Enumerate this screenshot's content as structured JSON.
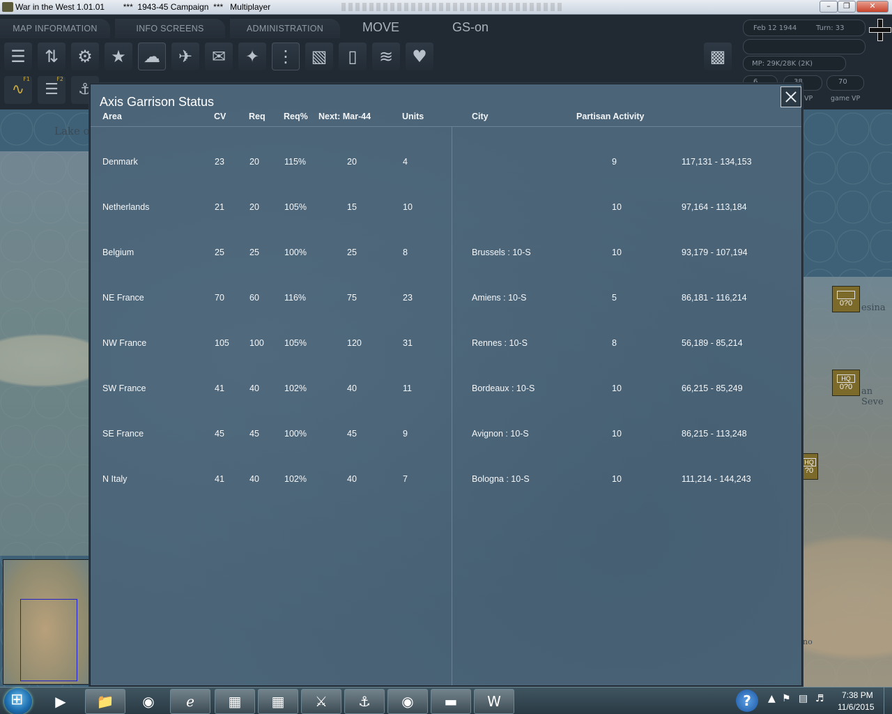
{
  "window": {
    "title": "War in the West 1.01.01        ***  1943-45 Campaign  ***   Multiplayer",
    "minimize_icon": "minimize-icon",
    "maximize_icon": "maximize-icon",
    "close_icon": "close-icon"
  },
  "topbar": {
    "tabs": [
      "MAP INFORMATION",
      "INFO SCREENS",
      "ADMINISTRATION"
    ],
    "mode": "MOVE",
    "gs": "GS-on",
    "toolbar_icons": [
      "unit-list-icon",
      "orders-icon",
      "gear-icon",
      "star-icon",
      "weather-icon",
      "air-ops-icon",
      "air-transfer-icon",
      "bomber-icon",
      "ground-units-icon",
      "rail-icon",
      "card-icon",
      "graph-icon",
      "airborne-icon"
    ],
    "f_keys": [
      {
        "icon": "road-icon",
        "key": "F1"
      },
      {
        "icon": "rail-track-icon",
        "key": "F2"
      },
      {
        "icon": "ship-icon",
        "key": ""
      }
    ]
  },
  "info": {
    "date": "Feb 12 1944",
    "turn": "Turn: 33",
    "mp": "MP: 29K/28K (2K)",
    "vp_values": [
      "6",
      "38",
      "70"
    ],
    "vp_labels": [
      "VP",
      "game VP"
    ]
  },
  "map": {
    "labels": [
      "Lake o",
      "esina",
      "an Seve",
      "no"
    ],
    "units": [
      {
        "tag": "",
        "val": "0?0"
      },
      {
        "tag": "HQ",
        "val": "0?0"
      },
      {
        "tag": "HQ",
        "val": "?0"
      }
    ]
  },
  "dialog": {
    "title": "Axis Garrison Status",
    "columns": [
      "Area",
      "CV",
      "Req",
      "Req%",
      "Next: Mar-44",
      "Units",
      "City",
      "Partisan Activity"
    ],
    "rows": [
      {
        "area": "Denmark",
        "cv": "23",
        "req": "20",
        "req_pct": "115%",
        "next": "20",
        "units": "4",
        "city": "",
        "partisan": "9",
        "range": "117,131 - 134,153"
      },
      {
        "area": "Netherlands",
        "cv": "21",
        "req": "20",
        "req_pct": "105%",
        "next": "15",
        "units": "10",
        "city": "",
        "partisan": "10",
        "range": "97,164 - 113,184"
      },
      {
        "area": "Belgium",
        "cv": "25",
        "req": "25",
        "req_pct": "100%",
        "next": "25",
        "units": "8",
        "city": "Brussels : 10-S",
        "partisan": "10",
        "range": "93,179 - 107,194"
      },
      {
        "area": "NE France",
        "cv": "70",
        "req": "60",
        "req_pct": "116%",
        "next": "75",
        "units": "23",
        "city": "Amiens : 10-S",
        "partisan": "5",
        "range": "86,181 - 116,214"
      },
      {
        "area": "NW France",
        "cv": "105",
        "req": "100",
        "req_pct": "105%",
        "next": "120",
        "units": "31",
        "city": "Rennes : 10-S",
        "partisan": "8",
        "range": "56,189 - 85,214"
      },
      {
        "area": "SW France",
        "cv": "41",
        "req": "40",
        "req_pct": "102%",
        "next": "40",
        "units": "11",
        "city": "Bordeaux : 10-S",
        "partisan": "10",
        "range": "66,215 - 85,249"
      },
      {
        "area": "SE France",
        "cv": "45",
        "req": "45",
        "req_pct": "100%",
        "next": "45",
        "units": "9",
        "city": "Avignon : 10-S",
        "partisan": "10",
        "range": "86,215 - 113,248"
      },
      {
        "area": "N Italy",
        "cv": "41",
        "req": "40",
        "req_pct": "102%",
        "next": "40",
        "units": "7",
        "city": "Bologna : 10-S",
        "partisan": "10",
        "range": "111,214 - 144,243"
      }
    ]
  },
  "taskbar": {
    "apps": [
      "media-player-icon",
      "file-explorer-icon",
      "hp-icon",
      "internet-explorer-icon",
      "store-icon",
      "calculator-icon",
      "game-1-icon",
      "world-of-warships-icon",
      "world-of-tanks-icon",
      "war-in-the-west-icon",
      "word-icon"
    ],
    "time": "7:38 PM",
    "date": "11/6/2015"
  }
}
